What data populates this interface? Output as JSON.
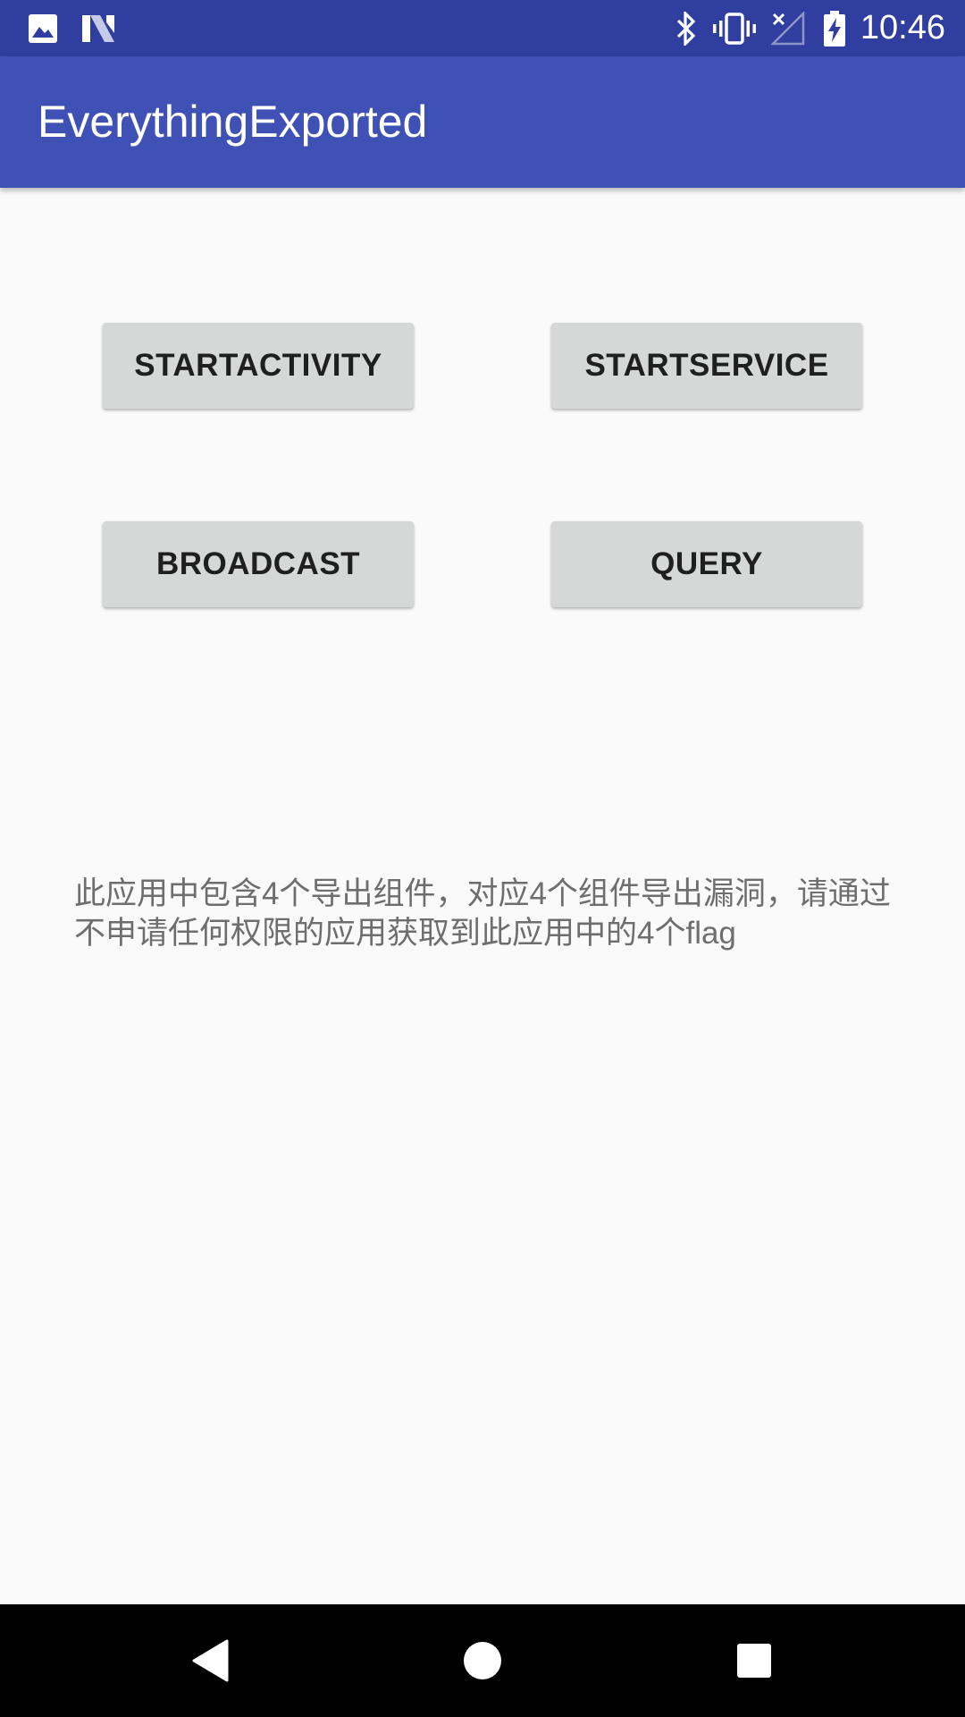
{
  "status_bar": {
    "time": "10:46",
    "icons": [
      "image-icon",
      "n-logo-icon",
      "bluetooth-icon",
      "vibrate-icon",
      "no-signal-icon",
      "battery-charging-icon"
    ]
  },
  "app_bar": {
    "title": "EverythingExported"
  },
  "buttons": {
    "start_activity": "STARTACTIVITY",
    "start_service": "STARTSERVICE",
    "broadcast": "BROADCAST",
    "query": "QUERY"
  },
  "info_text": "此应用中包含4个导出组件，对应4个组件导出漏洞，请通过不申请任何权限的应用获取到此应用中的4个flag",
  "nav_bar": {
    "icons": [
      "back-icon",
      "home-icon",
      "recents-icon"
    ]
  },
  "colors": {
    "status_bar": "#303f9f",
    "app_bar": "#3f51b5",
    "background": "#fafafa",
    "button": "#d6d7d7",
    "nav_bar": "#000000"
  }
}
